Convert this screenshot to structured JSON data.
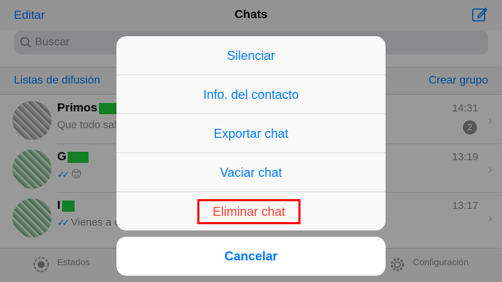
{
  "navbar": {
    "edit": "Editar",
    "title": "Chats"
  },
  "search": {
    "placeholder": "Buscar"
  },
  "lists": {
    "broadcast": "Listas de difusión",
    "new_group": "Crear grupo"
  },
  "chats": [
    {
      "name": "Primos",
      "message": "Que todo sal",
      "time": "14:31",
      "unread": "2"
    },
    {
      "name": "G",
      "message": "😊",
      "time": "13:19"
    },
    {
      "name": "I",
      "message": "Vienes a c",
      "time": "13:17"
    }
  ],
  "tabbar": {
    "status": "Estados",
    "settings": "Configuración"
  },
  "action_sheet": {
    "items": [
      "Silenciar",
      "Info. del contacto",
      "Exportar chat",
      "Vaciar chat",
      "Eliminar chat"
    ],
    "cancel": "Cancelar"
  },
  "colors": {
    "accent": "#007aff",
    "destructive": "#ff3b30",
    "highlight": "#ff0000",
    "redaction": "#1fd43c"
  }
}
